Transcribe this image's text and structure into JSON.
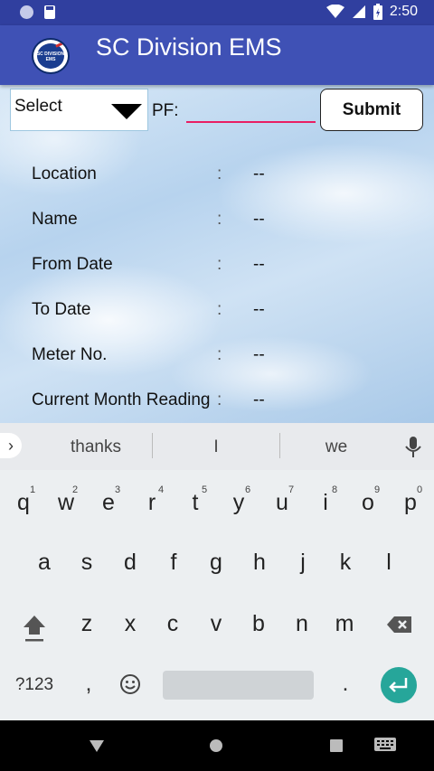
{
  "status_bar": {
    "time": "2:50"
  },
  "app": {
    "title": "SC Division EMS",
    "logo_text": "SC DIVISION EMS"
  },
  "form": {
    "select_value": "Select",
    "pf_label": "PF:",
    "pf_value": "",
    "submit_label": "Submit"
  },
  "fields": [
    {
      "label": "Location",
      "colon": ":",
      "value": "--"
    },
    {
      "label": "Name",
      "colon": ":",
      "value": "--"
    },
    {
      "label": "From Date",
      "colon": ":",
      "value": "--"
    },
    {
      "label": "To Date",
      "colon": ":",
      "value": "--"
    },
    {
      "label": "Meter No.",
      "colon": ":",
      "value": "--"
    },
    {
      "label": "Current Month Reading",
      "colon": ":",
      "value": "--"
    }
  ],
  "keyboard": {
    "suggestions": [
      "thanks",
      "I",
      "we"
    ],
    "row1": [
      "q",
      "w",
      "e",
      "r",
      "t",
      "y",
      "u",
      "i",
      "o",
      "p"
    ],
    "row1_hints": [
      "1",
      "2",
      "3",
      "4",
      "5",
      "6",
      "7",
      "8",
      "9",
      "0"
    ],
    "row2": [
      "a",
      "s",
      "d",
      "f",
      "g",
      "h",
      "j",
      "k",
      "l"
    ],
    "row3": [
      "z",
      "x",
      "c",
      "v",
      "b",
      "n",
      "m"
    ],
    "symbols_label": "?123",
    "comma": ",",
    "period": "."
  },
  "colors": {
    "status_bar": "#303f9f",
    "app_bar": "#3f51b5",
    "input_underline": "#e91e63",
    "enter_key": "#26a69a"
  }
}
